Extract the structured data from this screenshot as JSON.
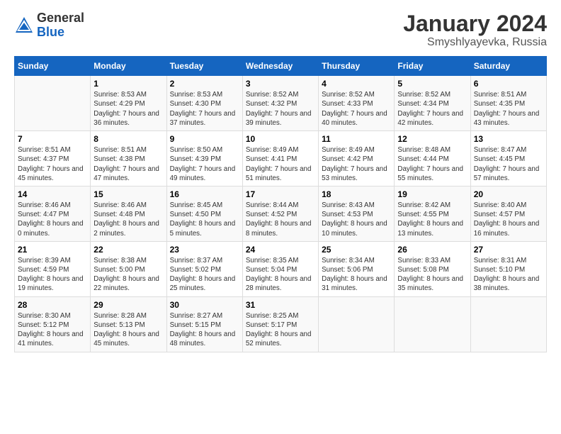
{
  "logo": {
    "general": "General",
    "blue": "Blue"
  },
  "title": "January 2024",
  "subtitle": "Smyshlyayevka, Russia",
  "days_of_week": [
    "Sunday",
    "Monday",
    "Tuesday",
    "Wednesday",
    "Thursday",
    "Friday",
    "Saturday"
  ],
  "weeks": [
    [
      {
        "day": "",
        "sunrise": "",
        "sunset": "",
        "daylight": ""
      },
      {
        "day": "1",
        "sunrise": "Sunrise: 8:53 AM",
        "sunset": "Sunset: 4:29 PM",
        "daylight": "Daylight: 7 hours and 36 minutes."
      },
      {
        "day": "2",
        "sunrise": "Sunrise: 8:53 AM",
        "sunset": "Sunset: 4:30 PM",
        "daylight": "Daylight: 7 hours and 37 minutes."
      },
      {
        "day": "3",
        "sunrise": "Sunrise: 8:52 AM",
        "sunset": "Sunset: 4:32 PM",
        "daylight": "Daylight: 7 hours and 39 minutes."
      },
      {
        "day": "4",
        "sunrise": "Sunrise: 8:52 AM",
        "sunset": "Sunset: 4:33 PM",
        "daylight": "Daylight: 7 hours and 40 minutes."
      },
      {
        "day": "5",
        "sunrise": "Sunrise: 8:52 AM",
        "sunset": "Sunset: 4:34 PM",
        "daylight": "Daylight: 7 hours and 42 minutes."
      },
      {
        "day": "6",
        "sunrise": "Sunrise: 8:51 AM",
        "sunset": "Sunset: 4:35 PM",
        "daylight": "Daylight: 7 hours and 43 minutes."
      }
    ],
    [
      {
        "day": "7",
        "sunrise": "Sunrise: 8:51 AM",
        "sunset": "Sunset: 4:37 PM",
        "daylight": "Daylight: 7 hours and 45 minutes."
      },
      {
        "day": "8",
        "sunrise": "Sunrise: 8:51 AM",
        "sunset": "Sunset: 4:38 PM",
        "daylight": "Daylight: 7 hours and 47 minutes."
      },
      {
        "day": "9",
        "sunrise": "Sunrise: 8:50 AM",
        "sunset": "Sunset: 4:39 PM",
        "daylight": "Daylight: 7 hours and 49 minutes."
      },
      {
        "day": "10",
        "sunrise": "Sunrise: 8:49 AM",
        "sunset": "Sunset: 4:41 PM",
        "daylight": "Daylight: 7 hours and 51 minutes."
      },
      {
        "day": "11",
        "sunrise": "Sunrise: 8:49 AM",
        "sunset": "Sunset: 4:42 PM",
        "daylight": "Daylight: 7 hours and 53 minutes."
      },
      {
        "day": "12",
        "sunrise": "Sunrise: 8:48 AM",
        "sunset": "Sunset: 4:44 PM",
        "daylight": "Daylight: 7 hours and 55 minutes."
      },
      {
        "day": "13",
        "sunrise": "Sunrise: 8:47 AM",
        "sunset": "Sunset: 4:45 PM",
        "daylight": "Daylight: 7 hours and 57 minutes."
      }
    ],
    [
      {
        "day": "14",
        "sunrise": "Sunrise: 8:46 AM",
        "sunset": "Sunset: 4:47 PM",
        "daylight": "Daylight: 8 hours and 0 minutes."
      },
      {
        "day": "15",
        "sunrise": "Sunrise: 8:46 AM",
        "sunset": "Sunset: 4:48 PM",
        "daylight": "Daylight: 8 hours and 2 minutes."
      },
      {
        "day": "16",
        "sunrise": "Sunrise: 8:45 AM",
        "sunset": "Sunset: 4:50 PM",
        "daylight": "Daylight: 8 hours and 5 minutes."
      },
      {
        "day": "17",
        "sunrise": "Sunrise: 8:44 AM",
        "sunset": "Sunset: 4:52 PM",
        "daylight": "Daylight: 8 hours and 8 minutes."
      },
      {
        "day": "18",
        "sunrise": "Sunrise: 8:43 AM",
        "sunset": "Sunset: 4:53 PM",
        "daylight": "Daylight: 8 hours and 10 minutes."
      },
      {
        "day": "19",
        "sunrise": "Sunrise: 8:42 AM",
        "sunset": "Sunset: 4:55 PM",
        "daylight": "Daylight: 8 hours and 13 minutes."
      },
      {
        "day": "20",
        "sunrise": "Sunrise: 8:40 AM",
        "sunset": "Sunset: 4:57 PM",
        "daylight": "Daylight: 8 hours and 16 minutes."
      }
    ],
    [
      {
        "day": "21",
        "sunrise": "Sunrise: 8:39 AM",
        "sunset": "Sunset: 4:59 PM",
        "daylight": "Daylight: 8 hours and 19 minutes."
      },
      {
        "day": "22",
        "sunrise": "Sunrise: 8:38 AM",
        "sunset": "Sunset: 5:00 PM",
        "daylight": "Daylight: 8 hours and 22 minutes."
      },
      {
        "day": "23",
        "sunrise": "Sunrise: 8:37 AM",
        "sunset": "Sunset: 5:02 PM",
        "daylight": "Daylight: 8 hours and 25 minutes."
      },
      {
        "day": "24",
        "sunrise": "Sunrise: 8:35 AM",
        "sunset": "Sunset: 5:04 PM",
        "daylight": "Daylight: 8 hours and 28 minutes."
      },
      {
        "day": "25",
        "sunrise": "Sunrise: 8:34 AM",
        "sunset": "Sunset: 5:06 PM",
        "daylight": "Daylight: 8 hours and 31 minutes."
      },
      {
        "day": "26",
        "sunrise": "Sunrise: 8:33 AM",
        "sunset": "Sunset: 5:08 PM",
        "daylight": "Daylight: 8 hours and 35 minutes."
      },
      {
        "day": "27",
        "sunrise": "Sunrise: 8:31 AM",
        "sunset": "Sunset: 5:10 PM",
        "daylight": "Daylight: 8 hours and 38 minutes."
      }
    ],
    [
      {
        "day": "28",
        "sunrise": "Sunrise: 8:30 AM",
        "sunset": "Sunset: 5:12 PM",
        "daylight": "Daylight: 8 hours and 41 minutes."
      },
      {
        "day": "29",
        "sunrise": "Sunrise: 8:28 AM",
        "sunset": "Sunset: 5:13 PM",
        "daylight": "Daylight: 8 hours and 45 minutes."
      },
      {
        "day": "30",
        "sunrise": "Sunrise: 8:27 AM",
        "sunset": "Sunset: 5:15 PM",
        "daylight": "Daylight: 8 hours and 48 minutes."
      },
      {
        "day": "31",
        "sunrise": "Sunrise: 8:25 AM",
        "sunset": "Sunset: 5:17 PM",
        "daylight": "Daylight: 8 hours and 52 minutes."
      },
      {
        "day": "",
        "sunrise": "",
        "sunset": "",
        "daylight": ""
      },
      {
        "day": "",
        "sunrise": "",
        "sunset": "",
        "daylight": ""
      },
      {
        "day": "",
        "sunrise": "",
        "sunset": "",
        "daylight": ""
      }
    ]
  ]
}
